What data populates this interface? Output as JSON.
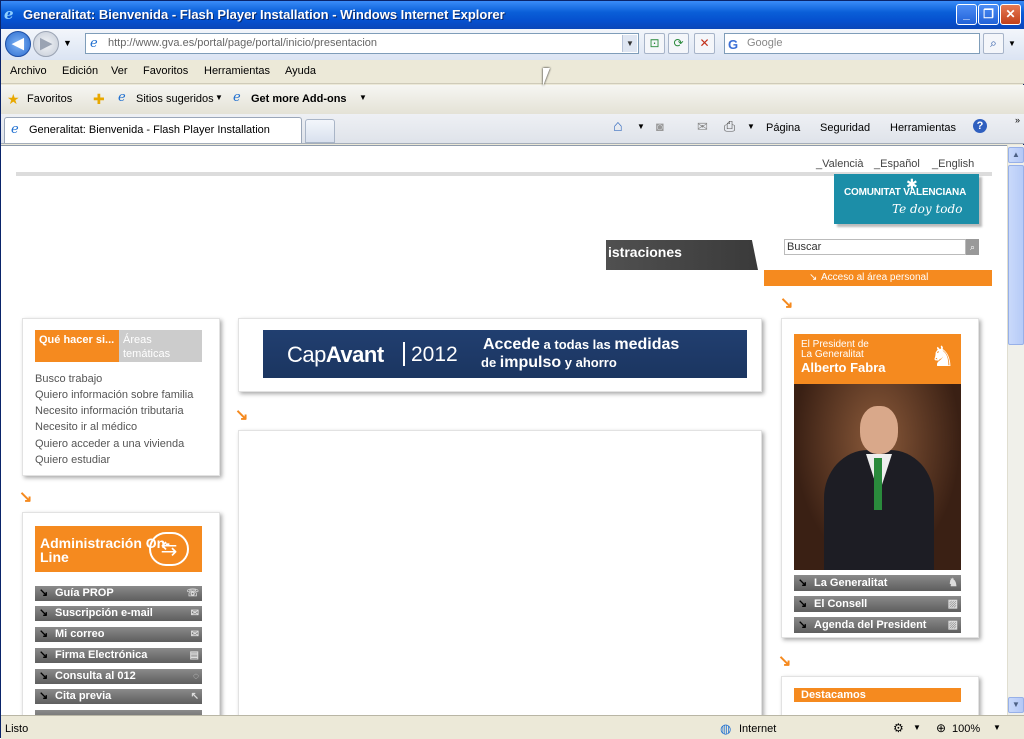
{
  "window": {
    "title": "Generalitat: Bienvenida - Flash Player Installation - Windows Internet Explorer",
    "buttons": {
      "minimize": "_",
      "restore": "❐",
      "close": "✕"
    }
  },
  "address_bar": {
    "url": "http://www.gva.es/portal/page/portal/inicio/presentacion",
    "search_placeholder": "Google"
  },
  "menu": [
    "Archivo",
    "Edición",
    "Ver",
    "Favoritos",
    "Herramientas",
    "Ayuda"
  ],
  "favorites_bar": {
    "favorites": "Favoritos",
    "suggested": "Sitios sugeridos",
    "addons": "Get more Add-ons"
  },
  "tab": {
    "title": "Generalitat: Bienvenida - Flash Player Installation"
  },
  "command_bar": {
    "page": "Página",
    "security": "Seguridad",
    "tools": "Herramientas"
  },
  "status": {
    "left": "Listo",
    "zone": "Internet",
    "zoom": "100%"
  },
  "page": {
    "languages": [
      "_Valencià",
      "_Español",
      "_English"
    ],
    "logo_line1": "COMUNITAT VALENCIANA",
    "logo_line2": "Te doy todo",
    "admin_tab": "istraciones",
    "search_placeholder": "Buscar",
    "personal_area": "Acceso al área personal",
    "que_hacer": {
      "tab_active": "Qué hacer si...",
      "tab_inactive": "Áreas temáticas",
      "links": [
        "Busco trabajo",
        "Quiero información sobre familia",
        "Necesito información tributaria",
        "Necesito ir al médico",
        "Quiero acceder a una vivienda",
        "Quiero estudiar"
      ]
    },
    "banner": {
      "cap": "Cap",
      "avant": "Avant",
      "year": "2012",
      "line1_a": "Accede",
      "line1_b": " a todas las ",
      "line1_c": "medidas",
      "line2_a": "de ",
      "line2_b": "impulso",
      "line2_c": " y ahorro"
    },
    "admin_online": {
      "title": "Administración On-Line",
      "items": [
        "Guía PROP",
        "Suscripción e-mail",
        "Mi correo",
        "Firma Electrónica",
        "Consulta al 012",
        "Cita previa"
      ]
    },
    "president": {
      "line1": "El President de",
      "line2": "La Generalitat",
      "name": "Alberto Fabra",
      "items": [
        "La Generalitat",
        "El Consell",
        "Agenda del President"
      ]
    },
    "destacamos": "Destacamos"
  }
}
